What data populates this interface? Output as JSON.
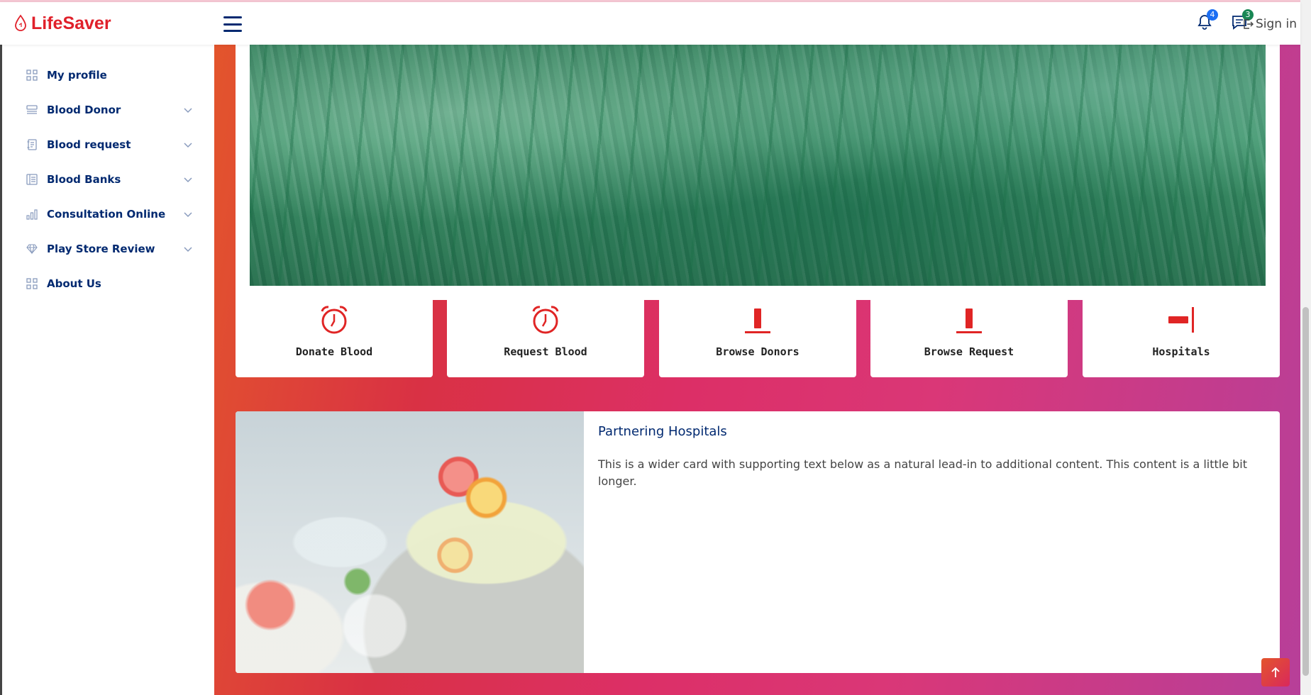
{
  "app": {
    "brand": "LifeSaver",
    "brand_color": "#e0202a",
    "nav_color": "#012970"
  },
  "header": {
    "notifications": {
      "icon": "bell-icon",
      "count": "4",
      "badge_color": "#1b6ef3"
    },
    "messages": {
      "icon": "chat-icon",
      "count": "3",
      "badge_color": "#198754"
    },
    "signin_label": "Sign in"
  },
  "sidebar": {
    "items": [
      {
        "label": "My profile",
        "icon": "grid-icon",
        "expandable": false
      },
      {
        "label": "Blood Donor",
        "icon": "menu-button-icon",
        "expandable": true
      },
      {
        "label": "Blood request",
        "icon": "journal-text-icon",
        "expandable": true
      },
      {
        "label": "Blood Banks",
        "icon": "layout-text-icon",
        "expandable": true
      },
      {
        "label": "Consultation Online",
        "icon": "bar-chart-icon",
        "expandable": true
      },
      {
        "label": "Play Store Review",
        "icon": "gem-icon",
        "expandable": true
      },
      {
        "label": "About Us",
        "icon": "grid-icon",
        "expandable": false
      }
    ]
  },
  "features": [
    {
      "label": "Donate Blood",
      "icon": "alarm-icon"
    },
    {
      "label": "Request Blood",
      "icon": "alarm-icon"
    },
    {
      "label": "Browse Donors",
      "icon": "align-bottom-icon"
    },
    {
      "label": "Browse Request",
      "icon": "align-bottom-icon"
    },
    {
      "label": "Hospitals",
      "icon": "align-end-icon"
    }
  ],
  "partner_card": {
    "title": "Partnering Hospitals",
    "text": "This is a wider card with supporting text below as a natural lead-in to additional content. This content is a little bit longer."
  },
  "accent_icon_color": "#e02525"
}
